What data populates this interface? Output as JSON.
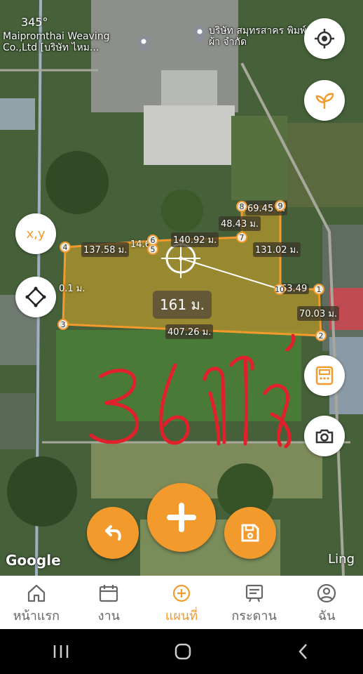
{
  "map": {
    "compass": "345°",
    "poi_left": "Maipromthai Weaving Co.,Ltd [บริษัท ไหม...",
    "poi_right": "บริษัท สมุทรสาคร พิมพ์ผ้า จำกัด",
    "xy_label": "x,y",
    "center_measure": "161 ม.",
    "annotation": "36ไร่",
    "google_logo": "Google",
    "corner_text": "Ling",
    "edge_labels": {
      "e1": "137.58 ม.",
      "e2": "14.6",
      "e3": "140.92 ม.",
      "e4": "48.43 ม.",
      "e5": "69.45 ม.",
      "e6": "131.02 ม.",
      "e7": "63.49",
      "e8": "70.03 ม.",
      "e9": "407.26 ม.",
      "e10": "0.1 ม."
    },
    "vertices": [
      "1",
      "2",
      "3",
      "4",
      "5",
      "6",
      "7",
      "8",
      "9",
      "10"
    ],
    "accent_color": "#f39a2d",
    "polygon_fill": "#b8972b"
  },
  "nav": [
    {
      "label": "หน้าแรก",
      "icon": "home-icon"
    },
    {
      "label": "งาน",
      "icon": "calendar-icon"
    },
    {
      "label": "แผนที่",
      "icon": "map-plus-icon"
    },
    {
      "label": "กระดาน",
      "icon": "board-icon"
    },
    {
      "label": "ฉัน",
      "icon": "user-icon"
    }
  ]
}
